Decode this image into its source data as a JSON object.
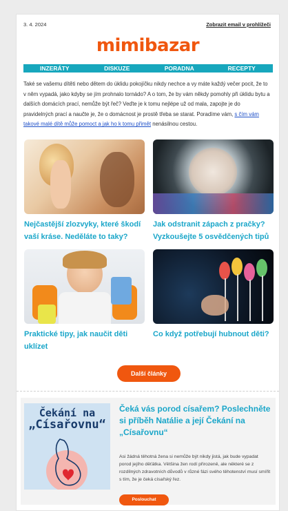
{
  "header": {
    "date": "3. 4. 2024",
    "view_in_browser": "Zobrazit email v prohlížeči",
    "logo": "mimibazar"
  },
  "nav": [
    "INZERÁTY",
    "DISKUZE",
    "PORADNA",
    "RECEPTY"
  ],
  "intro": {
    "text": "Také se vašemu dítěti nebo dětem do úklidu pokojíčku nikdy nechce a vy máte každý večer pocit, že to v něm vypadá, jako kdyby se jím prohnalo tornádo? A o tom, že by vám někdy pomohly při úklidu bytu a dalších domácích prací, nemůže být řeč? Veďte je k tomu nejlépe už od mala, zapojte je do pravidelných prací a naučte je, že o domácnost je prostě třeba se starat. Poradíme vám, ",
    "link": "s čím vám takové malé dítě může pomoct a jak ho k tomu přimět",
    "tail": " nenásilnou cestou."
  },
  "articles": [
    {
      "title": "Nejčastější zlozvyky, které škodí vaší kráse. Neděláte to taky?",
      "image_icon": "woman-mirror-photo"
    },
    {
      "title": "Jak odstranit zápach z pračky? Vyzkoušejte 5 osvědčených tipů",
      "image_icon": "washing-machine-photo"
    },
    {
      "title": "Praktické tipy, jak naučit děti uklízet",
      "image_icon": "child-cleaning-photo"
    },
    {
      "title": "Co když potřebují hubnout děti?",
      "image_icon": "lollipops-photo"
    }
  ],
  "more_button": "Další články",
  "podcast": {
    "cover_line1": "Čekání na",
    "cover_line2": "„Císařovnu“",
    "title": "Čeká vás porod císařem? Poslechněte si příběh Natálie a její Čekání na „Císařovnu“",
    "text": "Asi žádná těhotná žena si nemůže být nikdy jistá, jak bude vypadat porod jejího děťátka. Většina žen rodí přirozeně, ale některé se z rozdílných zdravotních důvodů v různé fázi svého těhotenství musí smířit s tím, že je čeká císařský řez.",
    "button": "Poslouchat"
  },
  "colors": {
    "accent": "#f0570f",
    "nav": "#17a7bd",
    "link": "#1aa6c9"
  }
}
